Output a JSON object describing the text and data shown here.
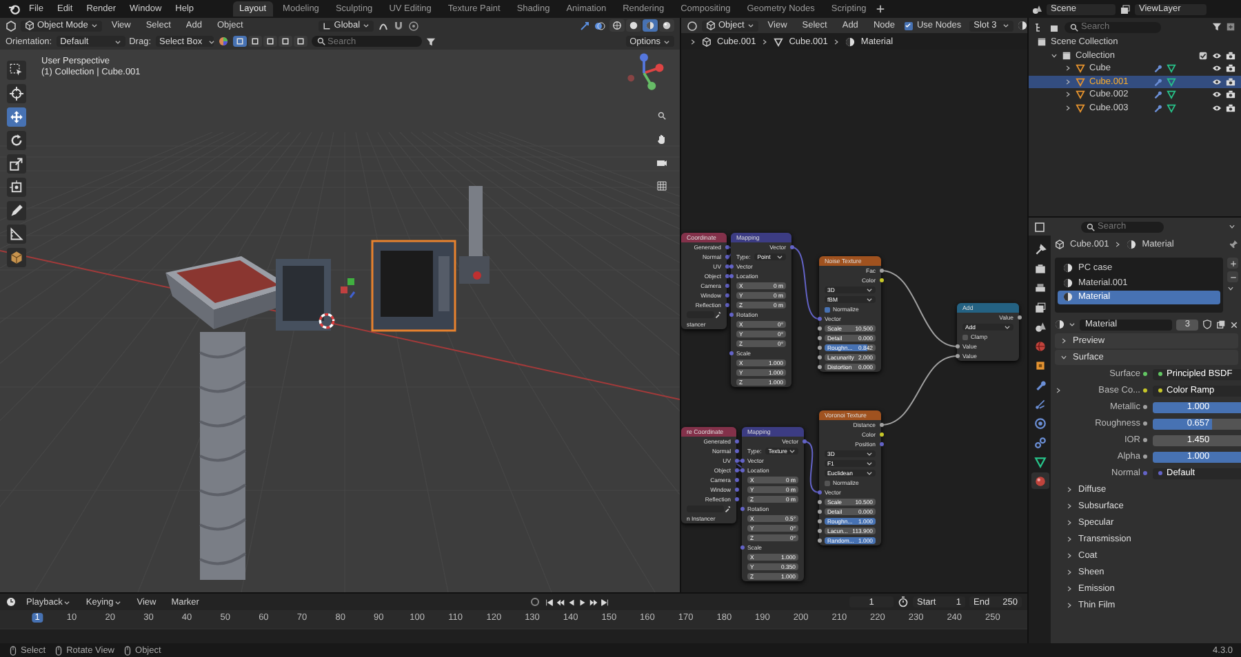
{
  "top_bar": {
    "menus": [
      "File",
      "Edit",
      "Render",
      "Window",
      "Help"
    ],
    "workspaces": [
      {
        "label": "Layout",
        "selected": true
      },
      {
        "label": "Modeling",
        "selected": false
      },
      {
        "label": "Sculpting",
        "selected": false
      },
      {
        "label": "UV Editing",
        "selected": false
      },
      {
        "label": "Texture Paint",
        "selected": false
      },
      {
        "label": "Shading",
        "selected": false
      },
      {
        "label": "Animation",
        "selected": false
      },
      {
        "label": "Rendering",
        "selected": false
      },
      {
        "label": "Compositing",
        "selected": false
      },
      {
        "label": "Geometry Nodes",
        "selected": false
      },
      {
        "label": "Scripting",
        "selected": false
      }
    ],
    "scene": "Scene",
    "view_layer": "ViewLayer"
  },
  "viewport": {
    "mode": "Object Mode",
    "menus": [
      "View",
      "Select",
      "Add",
      "Object"
    ],
    "transform": "Global",
    "shading_modes": [
      {
        "kind": "wireframe",
        "selected": false
      },
      {
        "kind": "solid",
        "selected": false
      },
      {
        "kind": "material",
        "selected": true
      },
      {
        "kind": "rendered",
        "selected": false
      }
    ],
    "orientation_label": "Orientation:",
    "orientation": "Default",
    "drag_label": "Drag:",
    "drag": "Select Box",
    "select_modes": [
      {
        "selected": true
      },
      {
        "selected": false
      },
      {
        "selected": false
      },
      {
        "selected": false
      },
      {
        "selected": false
      }
    ],
    "search": {
      "placeholder": "Search"
    },
    "options": "Options",
    "overlay_title": "User Perspective",
    "overlay_subtitle": "(1) Collection | Cube.001",
    "tools": [
      {
        "kind": "select",
        "selected": false
      },
      {
        "kind": "cursor",
        "selected": false
      },
      {
        "kind": "move",
        "selected": true
      },
      {
        "kind": "rotate",
        "selected": false
      },
      {
        "kind": "scale",
        "selected": false
      },
      {
        "kind": "transform",
        "selected": false
      },
      {
        "kind": "annotate",
        "selected": false
      },
      {
        "kind": "measure",
        "selected": false
      },
      {
        "kind": "add",
        "selected": false
      }
    ]
  },
  "node_editor": {
    "type": "Object",
    "menus": [
      "View",
      "Select",
      "Add",
      "Node"
    ],
    "use_nodes": {
      "label": "Use Nodes",
      "checked": true
    },
    "slot": "Slot 3",
    "breadcrumb": [
      "Cube.001",
      "Cube.001",
      "Material"
    ],
    "nodes": [
      {
        "title": "Coordinate",
        "kind": "input",
        "rows": [
          {
            "kind": "output",
            "label": "Generated",
            "color": "#6363c7"
          },
          {
            "kind": "output",
            "label": "Normal",
            "color": "#6363c7"
          },
          {
            "kind": "output",
            "label": "UV",
            "color": "#6363c7"
          },
          {
            "kind": "output",
            "label": "Object",
            "color": "#6363c7"
          },
          {
            "kind": "output",
            "label": "Camera",
            "color": "#6363c7"
          },
          {
            "kind": "output",
            "label": "Window",
            "color": "#6363c7"
          },
          {
            "kind": "output",
            "label": "Reflection",
            "color": "#6363c7"
          },
          {
            "kind": "picker"
          },
          {
            "kind": "text",
            "label": "stancer"
          }
        ]
      },
      {
        "title": "Mapping",
        "kind": "vector",
        "rows": [
          {
            "kind": "output",
            "label": "Vector",
            "color": "#6363c7"
          },
          {
            "kind": "menu",
            "label": "Type:",
            "value": "Point"
          },
          {
            "kind": "input",
            "label": "Vector",
            "color": "#6363c7"
          },
          {
            "kind": "input",
            "label": "Location",
            "color": "#6363c7"
          },
          {
            "kind": "field",
            "label": "X",
            "value": "0 m"
          },
          {
            "kind": "field",
            "label": "Y",
            "value": "0 m"
          },
          {
            "kind": "field",
            "label": "Z",
            "value": "0 m"
          },
          {
            "kind": "input",
            "label": "Rotation",
            "color": "#6363c7"
          },
          {
            "kind": "field",
            "label": "X",
            "value": "0°"
          },
          {
            "kind": "field",
            "label": "Y",
            "value": "0°"
          },
          {
            "kind": "field",
            "label": "Z",
            "value": "0°"
          },
          {
            "kind": "input",
            "label": "Scale",
            "color": "#6363c7"
          },
          {
            "kind": "field",
            "label": "X",
            "value": "1.000"
          },
          {
            "kind": "field",
            "label": "Y",
            "value": "1.000"
          },
          {
            "kind": "field",
            "label": "Z",
            "value": "1.000"
          }
        ]
      },
      {
        "title": "Noise Texture",
        "kind": "texture",
        "rows": [
          {
            "kind": "output",
            "label": "Fac",
            "color": "#a1a1a1"
          },
          {
            "kind": "output",
            "label": "Color",
            "color": "#c7c729"
          },
          {
            "kind": "menu",
            "value": "3D"
          },
          {
            "kind": "menu",
            "value": "fBM"
          },
          {
            "kind": "check",
            "label": "Normalize",
            "checked": true
          },
          {
            "kind": "input",
            "label": "Vector",
            "color": "#6363c7"
          },
          {
            "kind": "field",
            "label": "Scale",
            "value": "10.500",
            "color": "#a1a1a1"
          },
          {
            "kind": "field",
            "label": "Detail",
            "value": "0.000",
            "color": "#a1a1a1"
          },
          {
            "kind": "slider",
            "label": "Roughn...",
            "value": "0.842",
            "level": 0.84,
            "color": "#a1a1a1"
          },
          {
            "kind": "field",
            "label": "Lacunarity",
            "value": "2.000",
            "color": "#a1a1a1"
          },
          {
            "kind": "field",
            "label": "Distortion",
            "value": "0.000",
            "color": "#a1a1a1"
          }
        ]
      },
      {
        "title": "Add",
        "kind": "converter",
        "rows": [
          {
            "kind": "output",
            "label": "Value",
            "color": "#a1a1a1"
          },
          {
            "kind": "menu",
            "value": "Add"
          },
          {
            "kind": "check",
            "label": "Clamp",
            "checked": false
          },
          {
            "kind": "input",
            "label": "Value",
            "color": "#a1a1a1"
          },
          {
            "kind": "input",
            "label": "Value",
            "color": "#a1a1a1"
          }
        ]
      },
      {
        "title": "re Coordinate",
        "kind": "input",
        "rows": [
          {
            "kind": "output",
            "label": "Generated",
            "color": "#6363c7"
          },
          {
            "kind": "output",
            "label": "Normal",
            "color": "#6363c7"
          },
          {
            "kind": "output",
            "label": "UV",
            "color": "#6363c7"
          },
          {
            "kind": "output",
            "label": "Object",
            "color": "#6363c7"
          },
          {
            "kind": "output",
            "label": "Camera",
            "color": "#6363c7"
          },
          {
            "kind": "output",
            "label": "Window",
            "color": "#6363c7"
          },
          {
            "kind": "output",
            "label": "Reflection",
            "color": "#6363c7"
          },
          {
            "kind": "picker"
          },
          {
            "kind": "text",
            "label": "n Instancer"
          }
        ]
      },
      {
        "title": "Mapping",
        "kind": "vector",
        "rows": [
          {
            "kind": "output",
            "label": "Vector",
            "color": "#6363c7"
          },
          {
            "kind": "menu",
            "label": "Type:",
            "value": "Texture"
          },
          {
            "kind": "input",
            "label": "Vector",
            "color": "#6363c7"
          },
          {
            "kind": "input",
            "label": "Location",
            "color": "#6363c7"
          },
          {
            "kind": "field",
            "label": "X",
            "value": "0 m"
          },
          {
            "kind": "field",
            "label": "Y",
            "value": "0 m"
          },
          {
            "kind": "field",
            "label": "Z",
            "value": "0 m"
          },
          {
            "kind": "input",
            "label": "Rotation",
            "color": "#6363c7"
          },
          {
            "kind": "field",
            "label": "X",
            "value": "0.5°"
          },
          {
            "kind": "field",
            "label": "Y",
            "value": "0°"
          },
          {
            "kind": "field",
            "label": "Z",
            "value": "0°"
          },
          {
            "kind": "input",
            "label": "Scale",
            "color": "#6363c7"
          },
          {
            "kind": "field",
            "label": "X",
            "value": "1.000"
          },
          {
            "kind": "field",
            "label": "Y",
            "value": "0.350"
          },
          {
            "kind": "field",
            "label": "Z",
            "value": "1.000"
          }
        ]
      },
      {
        "title": "Voronoi Texture",
        "kind": "texture",
        "rows": [
          {
            "kind": "output",
            "label": "Distance",
            "color": "#a1a1a1"
          },
          {
            "kind": "output",
            "label": "Color",
            "color": "#c7c729"
          },
          {
            "kind": "output",
            "label": "Position",
            "color": "#6363c7"
          },
          {
            "kind": "menu",
            "value": "3D"
          },
          {
            "kind": "menu",
            "value": "F1"
          },
          {
            "kind": "menu",
            "value": "Euclidean"
          },
          {
            "kind": "check",
            "label": "Normalize",
            "checked": false
          },
          {
            "kind": "input",
            "label": "Vector",
            "color": "#6363c7"
          },
          {
            "kind": "field",
            "label": "Scale",
            "value": "10.500",
            "color": "#a1a1a1"
          },
          {
            "kind": "field",
            "label": "Detail",
            "value": "0.000",
            "color": "#a1a1a1"
          },
          {
            "kind": "slider",
            "label": "Roughn...",
            "value": "1.000",
            "level": 1,
            "color": "#a1a1a1"
          },
          {
            "kind": "field",
            "label": "Lacun...",
            "value": "113.900",
            "color": "#a1a1a1"
          },
          {
            "kind": "slider",
            "label": "Random...",
            "value": "1.000",
            "level": 1,
            "color": "#a1a1a1"
          }
        ]
      }
    ]
  },
  "outliner": {
    "search": {
      "placeholder": "Search"
    },
    "root": "Scene Collection",
    "children": [
      {
        "label": "Collection",
        "expanded": true,
        "children": [
          {
            "label": "Cube",
            "expanded": false,
            "selected": false
          },
          {
            "label": "Cube.001",
            "expanded": false,
            "selected": true
          },
          {
            "label": "Cube.002",
            "expanded": false,
            "selected": false
          },
          {
            "label": "Cube.003",
            "expanded": false,
            "selected": false
          }
        ]
      }
    ]
  },
  "properties": {
    "search": {
      "placeholder": "Search"
    },
    "tabs": [
      {
        "kind": "tool",
        "selected": false
      },
      {
        "kind": "render",
        "selected": false
      },
      {
        "kind": "output",
        "selected": false
      },
      {
        "kind": "view_layer",
        "selected": false
      },
      {
        "kind": "scene",
        "selected": false
      },
      {
        "kind": "world",
        "selected": false
      },
      {
        "kind": "object",
        "selected": false
      },
      {
        "kind": "modifier",
        "selected": false
      },
      {
        "kind": "particles",
        "selected": false
      },
      {
        "kind": "physics",
        "selected": false
      },
      {
        "kind": "constraints",
        "selected": false
      },
      {
        "kind": "data",
        "selected": false
      },
      {
        "kind": "material",
        "selected": true
      }
    ],
    "breadcrumb": [
      "Cube.001",
      "Material"
    ],
    "slots": [
      {
        "label": "PC case",
        "selected": false
      },
      {
        "label": "Material.001",
        "selected": false
      },
      {
        "label": "Material",
        "selected": true
      }
    ],
    "material": "Material",
    "users": "3",
    "panels": [
      {
        "kind": "panel",
        "label": "Preview",
        "expanded": false
      },
      {
        "kind": "panel",
        "label": "Surface",
        "expanded": true,
        "rows": [
          {
            "kind": "link",
            "label": "Surface",
            "value": "Principled BSDF",
            "color": "#63c763"
          },
          {
            "kind": "link",
            "label": "Base Co...",
            "value": "Color Ramp",
            "color": "#c7c729",
            "expanded": false
          },
          {
            "kind": "slider",
            "label": "Metallic",
            "value": "1.000",
            "level": 1,
            "color": "#a1a1a1"
          },
          {
            "kind": "slider",
            "label": "Roughness",
            "value": "0.657",
            "level": 0.657,
            "color": "#a1a1a1"
          },
          {
            "kind": "number",
            "label": "IOR",
            "value": "1.450",
            "color": "#a1a1a1"
          },
          {
            "kind": "slider",
            "label": "Alpha",
            "value": "1.000",
            "level": 1,
            "color": "#a1a1a1"
          },
          {
            "kind": "link",
            "label": "Normal",
            "value": "Default",
            "color": "#6363c7"
          }
        ]
      },
      {
        "kind": "subpanel",
        "label": "Diffuse",
        "expanded": false
      },
      {
        "kind": "subpanel",
        "label": "Subsurface",
        "expanded": false
      },
      {
        "kind": "subpanel",
        "label": "Specular",
        "expanded": false
      },
      {
        "kind": "subpanel",
        "label": "Transmission",
        "expanded": false
      },
      {
        "kind": "subpanel",
        "label": "Coat",
        "expanded": false
      },
      {
        "kind": "subpanel",
        "label": "Sheen",
        "expanded": false
      },
      {
        "kind": "subpanel",
        "label": "Emission",
        "expanded": false
      },
      {
        "kind": "subpanel",
        "label": "Thin Film",
        "expanded": false
      }
    ]
  },
  "timeline": {
    "menus": [
      "Playback",
      "Keying",
      "View",
      "Marker"
    ],
    "current_frame": "1",
    "start_label": "Start",
    "start": "1",
    "end_label": "End",
    "end": "250",
    "ruler": [
      {
        "label": "1",
        "selected": true
      },
      {
        "label": "10",
        "selected": false
      },
      {
        "label": "20",
        "selected": false
      },
      {
        "label": "30",
        "selected": false
      },
      {
        "label": "40",
        "selected": false
      },
      {
        "label": "50",
        "selected": false
      },
      {
        "label": "60",
        "selected": false
      },
      {
        "label": "70",
        "selected": false
      },
      {
        "label": "80",
        "selected": false
      },
      {
        "label": "90",
        "selected": false
      },
      {
        "label": "100",
        "selected": false
      },
      {
        "label": "110",
        "selected": false
      },
      {
        "label": "120",
        "selected": false
      },
      {
        "label": "130",
        "selected": false
      },
      {
        "label": "140",
        "selected": false
      },
      {
        "label": "150",
        "selected": false
      },
      {
        "label": "160",
        "selected": false
      },
      {
        "label": "170",
        "selected": false
      },
      {
        "label": "180",
        "selected": false
      },
      {
        "label": "190",
        "selected": false
      },
      {
        "label": "200",
        "selected": false
      },
      {
        "label": "210",
        "selected": false
      },
      {
        "label": "220",
        "selected": false
      },
      {
        "label": "230",
        "selected": false
      },
      {
        "label": "240",
        "selected": false
      },
      {
        "label": "250",
        "selected": false
      }
    ]
  },
  "status_bar": {
    "hints": [
      "Select",
      "Rotate View",
      "Object"
    ],
    "version": "4.3.0"
  }
}
